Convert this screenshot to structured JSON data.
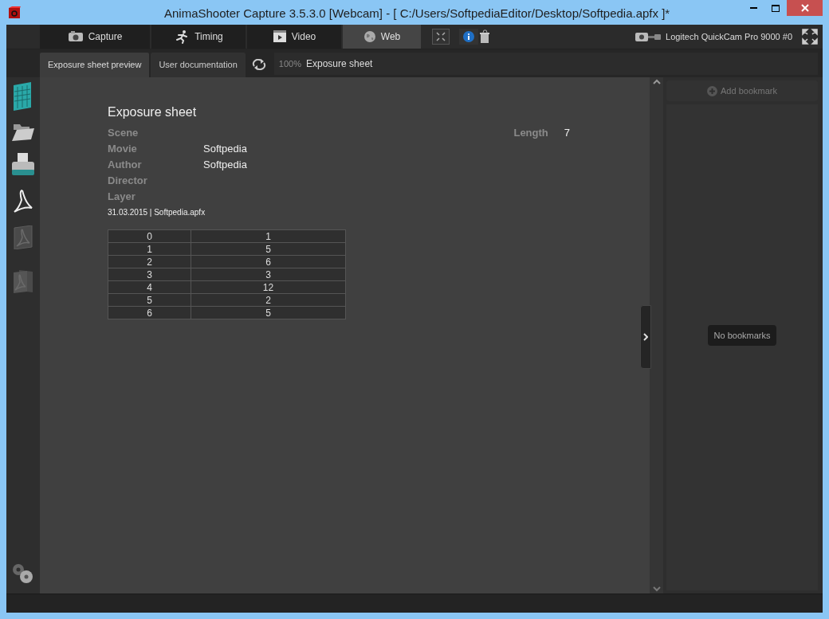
{
  "window": {
    "title": "AnimaShooter Capture 3.5.3.0 [Webcam]  - [ C:/Users/SoftpediaEditor/Desktop/Softpedia.apfx ]*"
  },
  "main_tabs": [
    {
      "label": "Capture",
      "selected": false,
      "kind": "camera"
    },
    {
      "label": "Timing",
      "selected": false,
      "kind": "runner"
    },
    {
      "label": "Video",
      "selected": false,
      "kind": "film"
    },
    {
      "label": "Web",
      "selected": true,
      "kind": "globe"
    }
  ],
  "camera_device": "Logitech QuickCam Pro 9000 #0",
  "sub_tabs": [
    {
      "label": "Exposure sheet preview",
      "selected": true
    },
    {
      "label": "User documentation",
      "selected": false
    }
  ],
  "zoom": "100%",
  "page_title": "Exposure sheet",
  "sheet": {
    "title": "Exposure sheet",
    "fields": [
      {
        "label": "Scene"
      },
      {
        "label": "Movie",
        "value": "Softpedia"
      },
      {
        "label": "Author",
        "value": "Softpedia"
      },
      {
        "label": "Director"
      },
      {
        "label": "Layer"
      }
    ],
    "length_label": "Length",
    "length_value": "7",
    "footer": "31.03.2015 | Softpedia.apfx",
    "rows": [
      [
        "0",
        "1"
      ],
      [
        "1",
        "5"
      ],
      [
        "2",
        "6"
      ],
      [
        "3",
        "3"
      ],
      [
        "4",
        "12"
      ],
      [
        "5",
        "2"
      ],
      [
        "6",
        "5"
      ]
    ]
  },
  "bookmarks": {
    "add": "Add bookmark",
    "empty": "No bookmarks"
  }
}
